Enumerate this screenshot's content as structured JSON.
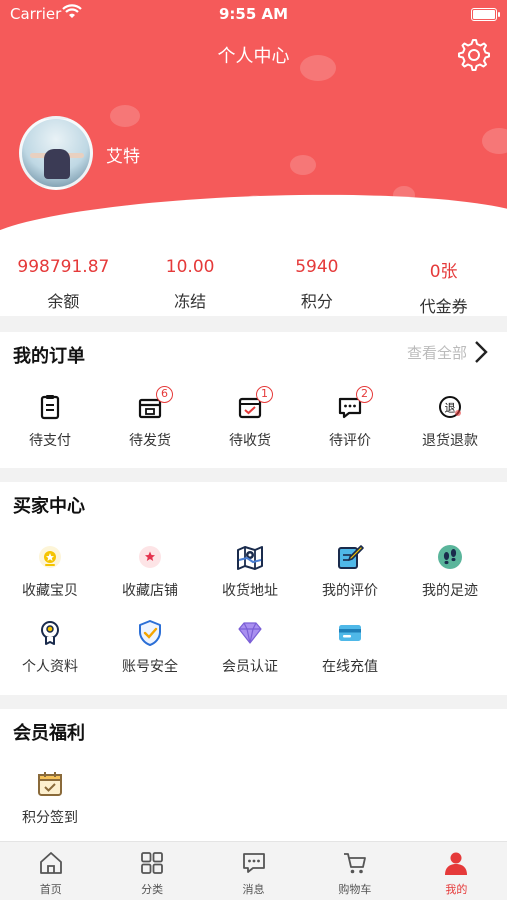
{
  "status_bar": {
    "carrier": "Carrier",
    "time": "9:55 AM"
  },
  "header": {
    "title": "个人中心",
    "username": "艾特"
  },
  "stats": [
    {
      "value": "998791.87",
      "label": "余额"
    },
    {
      "value": "10.00",
      "label": "冻结"
    },
    {
      "value": "5940",
      "label": "积分"
    },
    {
      "value": "0张",
      "label": "代金券"
    }
  ],
  "orders": {
    "title": "我的订单",
    "see_all": "查看全部",
    "items": [
      {
        "label": "待支付",
        "icon": "clipboard-icon",
        "badge": ""
      },
      {
        "label": "待发货",
        "icon": "box-icon",
        "badge": "6"
      },
      {
        "label": "待收货",
        "icon": "receive-icon",
        "badge": "1"
      },
      {
        "label": "待评价",
        "icon": "comment-icon",
        "badge": "2"
      },
      {
        "label": "退货退款",
        "icon": "refund-icon",
        "badge": ""
      }
    ]
  },
  "buyer": {
    "title": "买家中心",
    "items": [
      {
        "label": "收藏宝贝",
        "icon": "favorite-item-icon"
      },
      {
        "label": "收藏店铺",
        "icon": "favorite-shop-icon"
      },
      {
        "label": "收货地址",
        "icon": "map-icon"
      },
      {
        "label": "我的评价",
        "icon": "edit-review-icon"
      },
      {
        "label": "我的足迹",
        "icon": "footprint-icon"
      },
      {
        "label": "个人资料",
        "icon": "profile-icon"
      },
      {
        "label": "账号安全",
        "icon": "shield-icon"
      },
      {
        "label": "会员认证",
        "icon": "diamond-icon"
      },
      {
        "label": "在线充值",
        "icon": "card-icon"
      }
    ]
  },
  "benefits": {
    "title": "会员福利",
    "items": [
      {
        "label": "积分签到",
        "icon": "calendar-check-icon"
      }
    ]
  },
  "tabbar": [
    {
      "label": "首页",
      "icon": "home-icon"
    },
    {
      "label": "分类",
      "icon": "grid-icon"
    },
    {
      "label": "消息",
      "icon": "message-icon"
    },
    {
      "label": "购物车",
      "icon": "cart-icon"
    },
    {
      "label": "我的",
      "icon": "user-icon",
      "active": true
    }
  ],
  "colors": {
    "brand": "#f55a5a",
    "accent": "#e53a3a"
  }
}
